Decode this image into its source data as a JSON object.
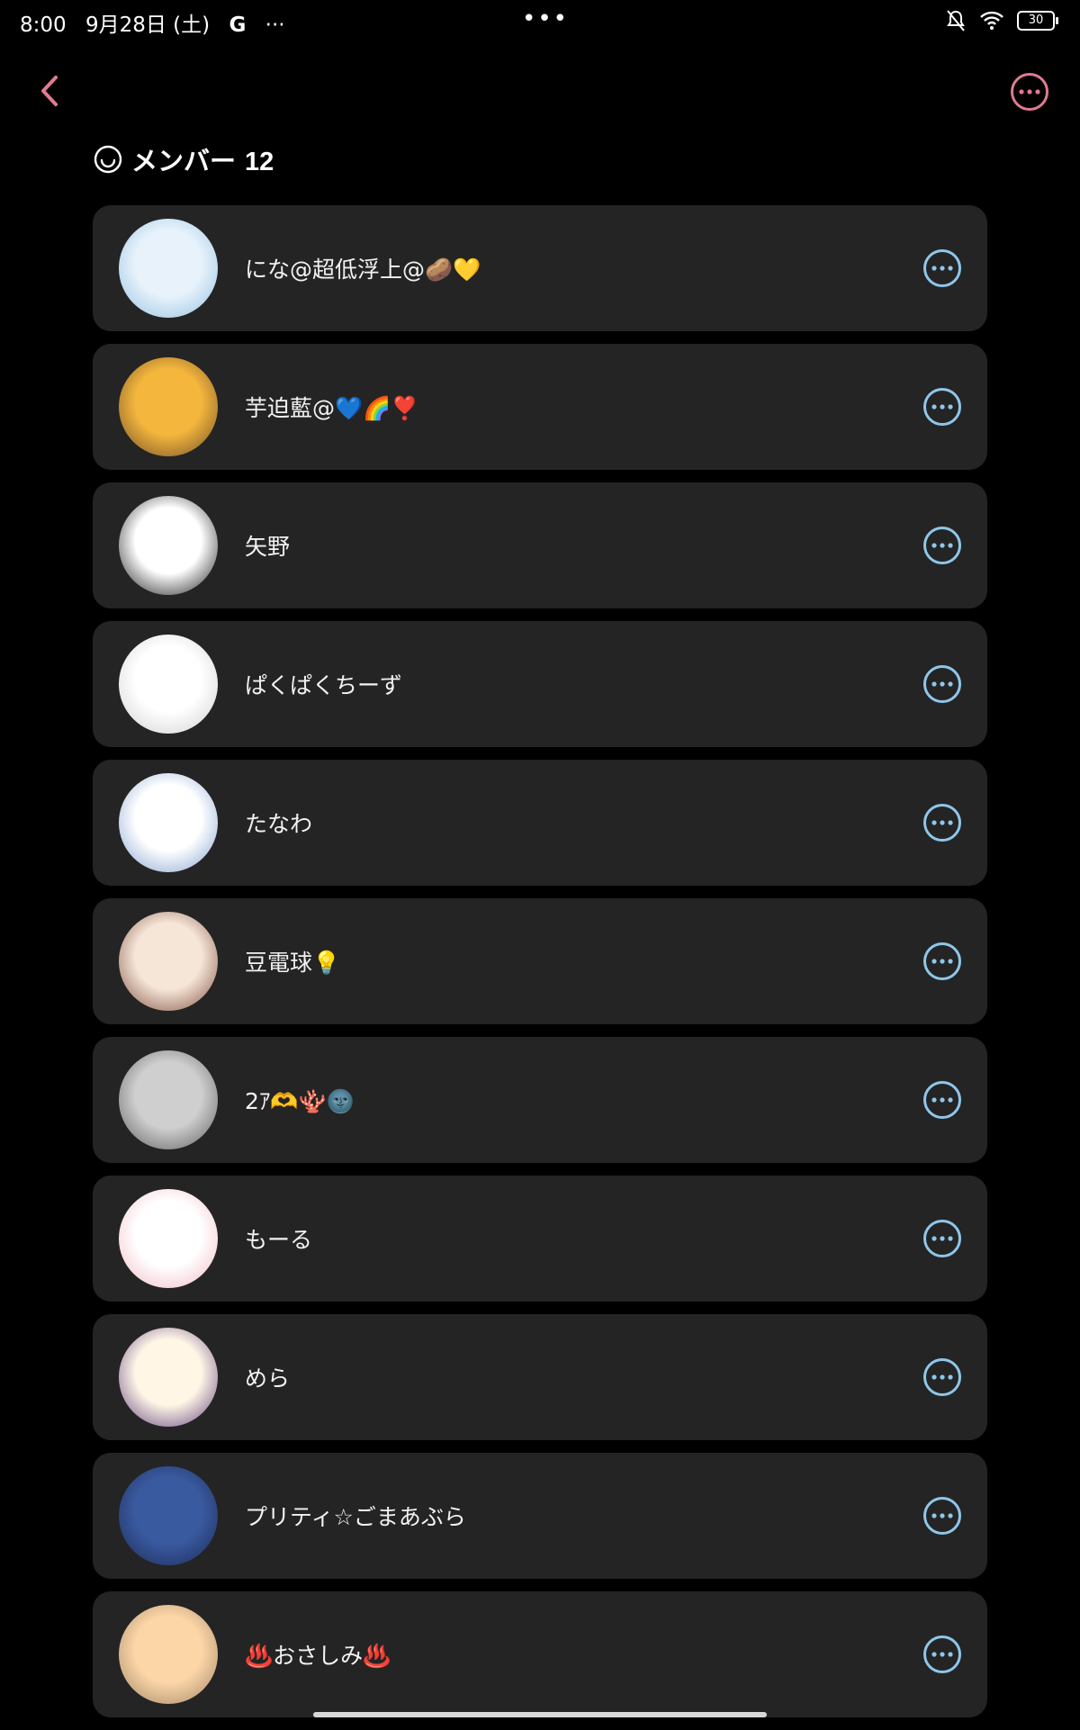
{
  "status_bar": {
    "time": "8:00",
    "date": "9月28日 (土)",
    "google_glyph": "G",
    "ellipsis": "···",
    "center_dots": "•••",
    "battery": "30"
  },
  "header": {
    "title": "メンバー",
    "count": "12"
  },
  "members": [
    {
      "name": "にな@超低浮上@🥔💛",
      "avatar_colors": [
        "#e8f2fb",
        "#8fc0e0"
      ]
    },
    {
      "name": "芋迫藍@💙🌈❣️",
      "avatar_colors": [
        "#f4b63c",
        "#6b4a2a"
      ]
    },
    {
      "name": "矢野",
      "avatar_colors": [
        "#ffffff",
        "#111111"
      ]
    },
    {
      "name": "ぱくぱくちーず",
      "avatar_colors": [
        "#ffffff",
        "#cfcfcf"
      ]
    },
    {
      "name": "たなわ",
      "avatar_colors": [
        "#ffffff",
        "#7f9fcf"
      ]
    },
    {
      "name": "豆電球💡",
      "avatar_colors": [
        "#f6e6d8",
        "#7a4a3a"
      ]
    },
    {
      "name": "2ｱ🫶🪸🌚",
      "avatar_colors": [
        "#cfcfcf",
        "#5a5a5a"
      ]
    },
    {
      "name": "もーる",
      "avatar_colors": [
        "#ffffff",
        "#f2b8c0"
      ]
    },
    {
      "name": "めら",
      "avatar_colors": [
        "#fff6e6",
        "#5a3a7a"
      ]
    },
    {
      "name": "プリティ☆ごまあぶら",
      "avatar_colors": [
        "#3a5aa0",
        "#1c2a55"
      ]
    },
    {
      "name": "♨️おさしみ♨️",
      "avatar_colors": [
        "#fdd6a8",
        "#9c8464"
      ]
    }
  ],
  "colors": {
    "accent_pink": "#e07a90",
    "icon_blue": "#8ec6ea",
    "card_bg": "#242424",
    "background": "#000000"
  },
  "icons": {
    "back": "chevron-left-icon",
    "menu": "more-horizontal-circle-icon",
    "header": "smiley-face-icon",
    "row_more": "more-horizontal-circle-icon"
  }
}
